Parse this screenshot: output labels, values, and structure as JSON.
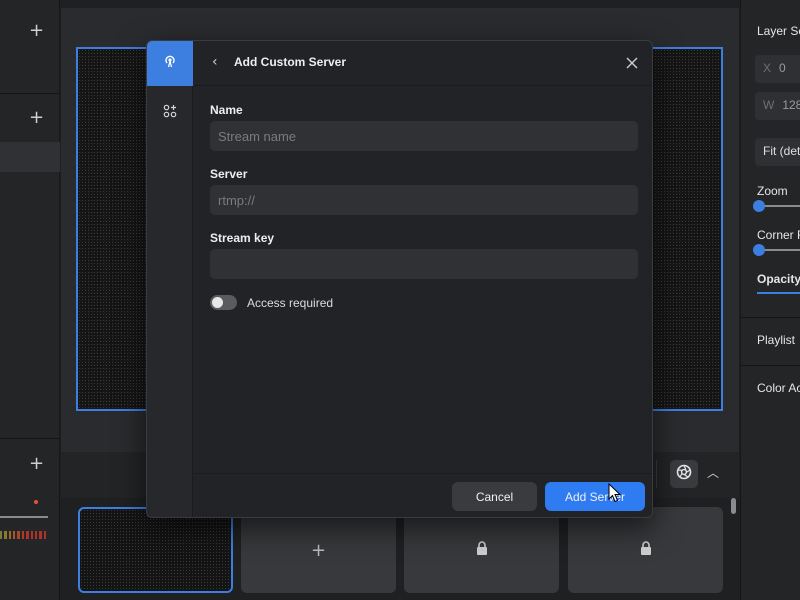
{
  "left_panel": {
    "add_icon": "plus-icon"
  },
  "right_panel": {
    "layer_settings_label": "Layer Se",
    "x_field": {
      "axis": "X",
      "value": "0"
    },
    "w_field": {
      "axis": "W",
      "value": "128"
    },
    "fit_select": "Fit (det",
    "zoom_label": "Zoom",
    "corner_label": "Corner R",
    "opacity_label": "Opacity",
    "playlist_label": "Playlist",
    "color_label": "Color Ac",
    "zoom_level": 0.0,
    "corner_level": 0.0
  },
  "modal": {
    "title": "Add Custom Server",
    "back_icon": "chevron-left-icon",
    "close_icon": "close-icon",
    "sidebar_icons": [
      "broadcast-icon",
      "add-widget-icon"
    ],
    "name": {
      "label": "Name",
      "placeholder": "Stream name",
      "value": ""
    },
    "server": {
      "label": "Server",
      "placeholder": "rtmp://",
      "value": ""
    },
    "stream_key": {
      "label": "Stream key",
      "placeholder": "",
      "value": ""
    },
    "access_toggle": {
      "label": "Access required",
      "on": false
    },
    "cancel_label": "Cancel",
    "add_label": "Add Server"
  },
  "scene_bar": {
    "camera_icon": "aperture-icon",
    "collapse_icon": "chevron-up-icon",
    "thumbnails": [
      {
        "kind": "active"
      },
      {
        "kind": "add",
        "icon": "plus-icon"
      },
      {
        "kind": "locked",
        "icon": "lock-icon"
      },
      {
        "kind": "locked",
        "icon": "lock-icon"
      }
    ]
  },
  "colors": {
    "accent": "#2f7bf1",
    "selection": "#3d7fe0",
    "meter_green": "#7a9a3a",
    "meter_red": "#c0392b"
  }
}
